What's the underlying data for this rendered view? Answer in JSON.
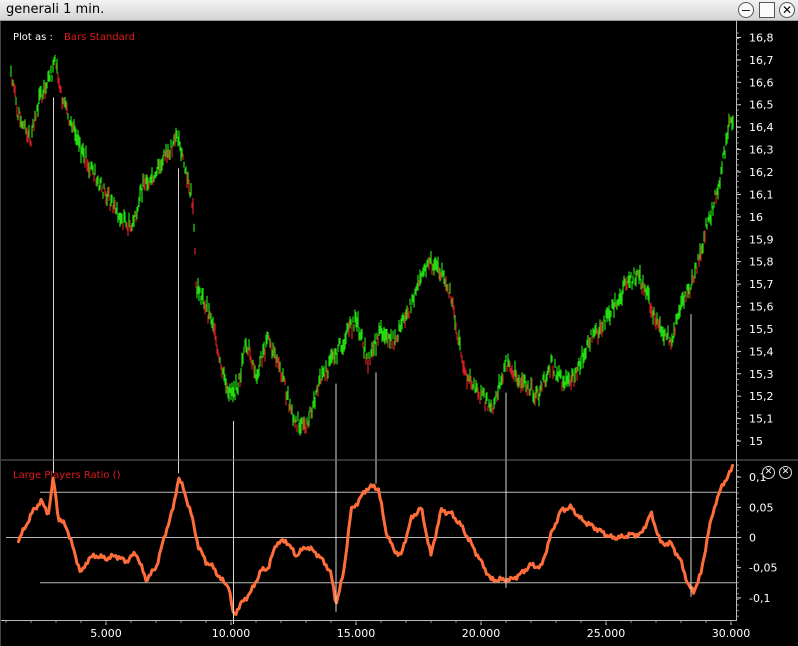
{
  "window": {
    "title": "generali  1 min."
  },
  "plot_as": {
    "label": "Plot as :",
    "value": "Bars Standard"
  },
  "indicator": {
    "label": "Large Players Ratio ()"
  },
  "colors": {
    "bars_up": "#22dd11",
    "bars_down": "#d42020",
    "ratio_line": "#ff6e3a",
    "guide_lines": "#bbbbbb",
    "marker_lines": "#d8d8d8"
  },
  "chart_data": [
    {
      "type": "line",
      "title": "",
      "legend": "Bars Standard",
      "x_ticks": [
        "5.000",
        "10.000",
        "15.000",
        "20.000",
        "25.000",
        "30.000"
      ],
      "x_tick_values": [
        5000,
        10000,
        15000,
        20000,
        25000,
        30000
      ],
      "y_ticks": [
        "16,8",
        "16,7",
        "16,6",
        "16,5",
        "16,4",
        "16,3",
        "16,2",
        "16,1",
        "16",
        "15,9",
        "15,8",
        "15,7",
        "15,6",
        "15,5",
        "15,4",
        "15,3",
        "15,2",
        "15,1",
        "15"
      ],
      "y_tick_values": [
        16.8,
        16.7,
        16.6,
        16.5,
        16.4,
        16.3,
        16.2,
        16.1,
        16.0,
        15.9,
        15.8,
        15.7,
        15.6,
        15.5,
        15.4,
        15.3,
        15.2,
        15.1,
        15.0
      ],
      "ylim": [
        14.96,
        16.82
      ],
      "xlim": [
        1000,
        30200
      ],
      "series": [
        {
          "name": "Bars Standard",
          "x": [
            1200,
            1500,
            2000,
            2400,
            2700,
            3000,
            3200,
            3500,
            4000,
            4500,
            5000,
            5500,
            6000,
            6500,
            7000,
            7500,
            7900,
            8200,
            8400,
            8500,
            8600,
            9000,
            9300,
            9700,
            10000,
            10300,
            10600,
            11000,
            11500,
            12000,
            12500,
            13000,
            13500,
            14000,
            14500,
            15000,
            15500,
            16000,
            16500,
            17000,
            17500,
            18000,
            18500,
            18900,
            19300,
            19700,
            20000,
            20500,
            21000,
            21300,
            21800,
            22300,
            22800,
            23300,
            23800,
            24300,
            24800,
            25300,
            25800,
            26300,
            26800,
            27200,
            27600,
            28000,
            28400,
            28800,
            29000,
            29300,
            29600,
            29900,
            30100
          ],
          "y": [
            16.65,
            16.45,
            16.35,
            16.55,
            16.6,
            16.7,
            16.55,
            16.45,
            16.3,
            16.2,
            16.1,
            16.0,
            15.95,
            16.15,
            16.2,
            16.3,
            16.35,
            16.2,
            16.1,
            16.05,
            15.7,
            15.6,
            15.5,
            15.3,
            15.2,
            15.25,
            15.45,
            15.3,
            15.45,
            15.3,
            15.1,
            15.05,
            15.25,
            15.35,
            15.45,
            15.55,
            15.35,
            15.5,
            15.45,
            15.55,
            15.7,
            15.8,
            15.75,
            15.6,
            15.3,
            15.25,
            15.2,
            15.15,
            15.35,
            15.3,
            15.25,
            15.2,
            15.35,
            15.25,
            15.3,
            15.45,
            15.5,
            15.6,
            15.7,
            15.75,
            15.6,
            15.5,
            15.45,
            15.6,
            15.7,
            15.85,
            15.95,
            16.05,
            16.2,
            16.4,
            16.45
          ]
        }
      ]
    },
    {
      "type": "line",
      "title": "",
      "legend": "Large Players Ratio ()",
      "y_ticks": [
        "0,1",
        "0,05",
        "0",
        "-0,05",
        "-0,1"
      ],
      "y_tick_values": [
        0.1,
        0.05,
        0,
        -0.05,
        -0.1
      ],
      "ylim": [
        -0.135,
        0.125
      ],
      "guide_lines": [
        0.075,
        0,
        -0.075
      ],
      "marker_x": [
        2900,
        7900,
        10100,
        14200,
        15800,
        21000,
        28400
      ],
      "series": [
        {
          "name": "Large Players Ratio ()",
          "x": [
            1500,
            1800,
            2100,
            2400,
            2700,
            2900,
            3100,
            3400,
            3700,
            4000,
            4300,
            4600,
            5000,
            5400,
            5800,
            6200,
            6600,
            7000,
            7400,
            7700,
            7900,
            8100,
            8400,
            8700,
            9000,
            9300,
            9600,
            9900,
            10100,
            10400,
            10800,
            11200,
            11500,
            11800,
            12200,
            12600,
            13000,
            13400,
            13800,
            14000,
            14200,
            14500,
            14800,
            15100,
            15400,
            15700,
            15900,
            16200,
            16500,
            16800,
            17200,
            17600,
            18000,
            18400,
            18800,
            19200,
            19600,
            20000,
            20400,
            20800,
            21200,
            21600,
            22000,
            22400,
            22800,
            23200,
            23600,
            24000,
            24400,
            24800,
            25200,
            25600,
            26000,
            26400,
            26800,
            27200,
            27600,
            28000,
            28300,
            28500,
            28800,
            29100,
            29400,
            29700,
            30000,
            30100
          ],
          "y": [
            -0.005,
            0.02,
            0.045,
            0.06,
            0.04,
            0.1,
            0.03,
            0.02,
            -0.02,
            -0.06,
            -0.035,
            -0.03,
            -0.035,
            -0.03,
            -0.04,
            -0.025,
            -0.07,
            -0.05,
            0.01,
            0.05,
            0.1,
            0.08,
            0.04,
            -0.015,
            -0.04,
            -0.05,
            -0.07,
            -0.08,
            -0.13,
            -0.11,
            -0.09,
            -0.055,
            -0.05,
            -0.01,
            -0.005,
            -0.03,
            -0.015,
            -0.025,
            -0.045,
            -0.06,
            -0.11,
            -0.06,
            0.045,
            0.06,
            0.08,
            0.085,
            0.08,
            0.01,
            -0.02,
            -0.03,
            0.03,
            0.05,
            -0.03,
            0.045,
            0.04,
            0.02,
            -0.01,
            -0.04,
            -0.07,
            -0.07,
            -0.07,
            -0.06,
            -0.045,
            -0.05,
            0.005,
            0.045,
            0.05,
            0.03,
            0.02,
            0.01,
            0.0,
            0.0,
            0.005,
            0.005,
            0.04,
            -0.01,
            -0.01,
            -0.04,
            -0.08,
            -0.09,
            -0.06,
            0.01,
            0.06,
            0.09,
            0.11,
            0.12
          ]
        }
      ]
    }
  ]
}
